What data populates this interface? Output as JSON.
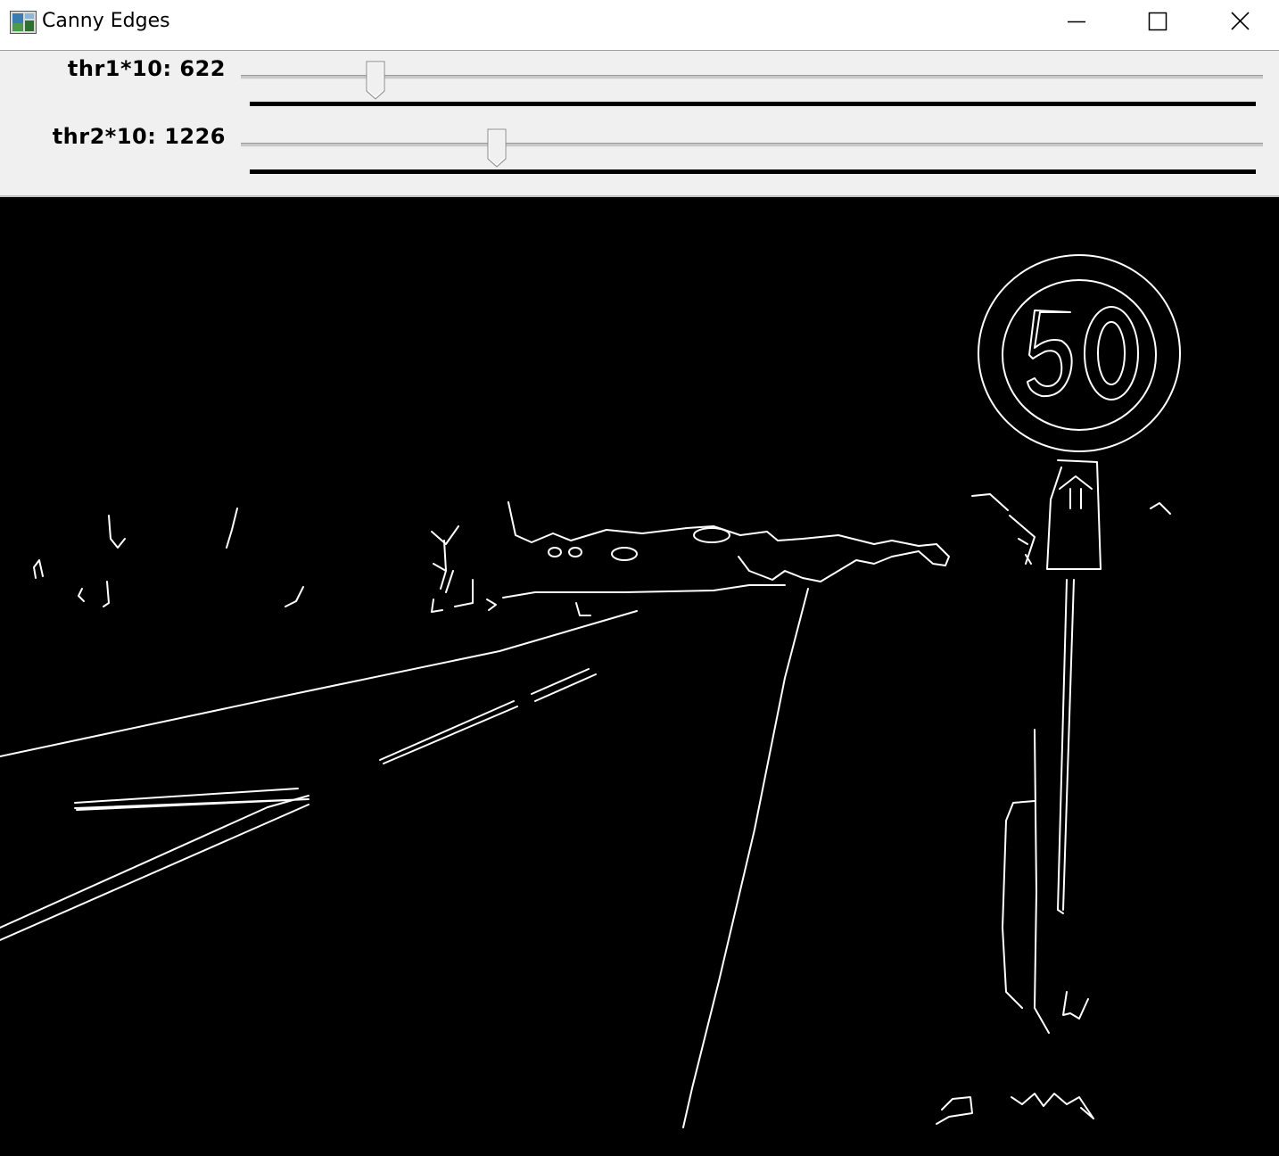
{
  "window": {
    "title": "Canny Edges",
    "icon": "opencv-window-icon",
    "controls": [
      "minimize-icon",
      "maximize-icon",
      "close-icon"
    ]
  },
  "trackbars": [
    {
      "label": "thr1*10: 622",
      "name": "thr1*10",
      "value": 622,
      "max": 5000
    },
    {
      "label": "thr2*10: 1226",
      "name": "thr2*10",
      "value": 1226,
      "max": 5000
    }
  ],
  "image": {
    "description_free": true,
    "sign_text": "50",
    "colors": {
      "background": "#000000",
      "edges": "#ffffff"
    }
  }
}
